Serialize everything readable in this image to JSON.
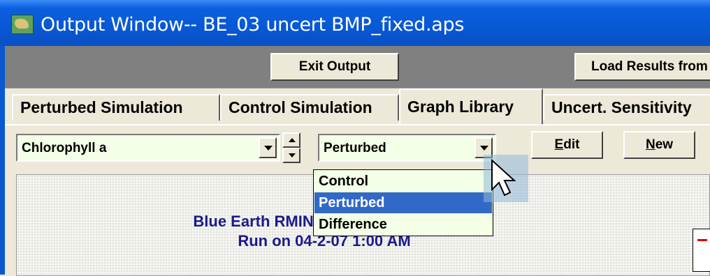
{
  "window": {
    "title": "Output Window-- BE_03 uncert BMP_fixed.aps",
    "icon": "app-icon"
  },
  "toolbar": {
    "exit_label": "Exit Output",
    "load_label": "Load Results from"
  },
  "tabs": [
    {
      "label": "Perturbed Simulation",
      "active": false
    },
    {
      "label": "Control Simulation",
      "active": false
    },
    {
      "label": "Graph Library",
      "active": true
    },
    {
      "label": "Uncert. Sensitivity",
      "active": false
    }
  ],
  "controls": {
    "variable_value": "Chlorophyll a",
    "mode_value": "Perturbed",
    "edit_label": "Edit",
    "edit_hotkey": "E",
    "edit_rest": "dit",
    "new_label": "New",
    "new_hotkey": "N",
    "new_rest": "ew"
  },
  "dropdown": {
    "options": [
      "Control",
      "Perturbed",
      "Difference"
    ],
    "selected_index": 1
  },
  "graph": {
    "title_line1": "Blue Earth RMIN (04) (PERTURBED)",
    "title_line2": "Run on 04-2-07 1:00 AM"
  },
  "colors": {
    "title_bar": "#0b5fe0",
    "selection": "#3169c6",
    "field_bg": "#f3ffe6",
    "graph_title": "#1a1a8c"
  }
}
